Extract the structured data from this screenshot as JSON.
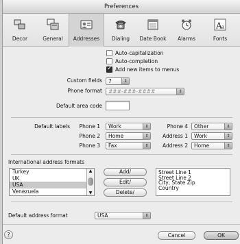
{
  "window": {
    "title": "Preferences"
  },
  "toolbar": {
    "items": [
      {
        "label": "Decor",
        "icon": "decor-icon"
      },
      {
        "label": "General",
        "icon": "general-icon"
      },
      {
        "label": "Addresses",
        "icon": "addresses-icon"
      },
      {
        "label": "Dialing",
        "icon": "telephone-icon"
      },
      {
        "label": "Date Book",
        "icon": "date-book-icon"
      },
      {
        "label": "Alarms",
        "icon": "alarm-clock-icon"
      },
      {
        "label": "Fonts",
        "icon": "fonts-icon"
      }
    ],
    "selected": "Addresses"
  },
  "options": {
    "auto_capitalization": {
      "label": "Auto-capitalization",
      "checked": false
    },
    "auto_completion": {
      "label": "Auto-completion",
      "checked": false
    },
    "add_new_items": {
      "label": "Add new items to menus",
      "checked": true
    }
  },
  "custom_fields": {
    "label": "Custom fields",
    "value": "7"
  },
  "phone_format": {
    "label": "Phone format",
    "value": "###-###-####"
  },
  "default_area_code": {
    "label": "Default area code",
    "value": ""
  },
  "default_labels": {
    "label": "Default labels",
    "rows": [
      {
        "left_label": "Phone 1",
        "left_value": "Work",
        "right_label": "Phone 4",
        "right_value": "Other"
      },
      {
        "left_label": "Phone 2",
        "left_value": "Home",
        "right_label": "Address 1",
        "right_value": "Work"
      },
      {
        "left_label": "Phone 3",
        "left_value": "Fax",
        "right_label": "Address 2",
        "right_value": "Home"
      }
    ]
  },
  "international": {
    "label": "International address formats",
    "countries": [
      "Turkey",
      "UK",
      "USA",
      "Venezuela"
    ],
    "selected": "USA",
    "buttons": {
      "add": "Add/",
      "edit": "Edit/",
      "delete": "Delete/"
    },
    "preview": [
      "Street Line 1",
      "Street Line 2",
      "City, State Zip",
      "Country"
    ]
  },
  "default_address_format": {
    "label": "Default address format",
    "value": "USA"
  },
  "footer": {
    "help": "?",
    "cancel": "Cancel",
    "ok": "OK"
  },
  "colors": {
    "window_bg": "#ececec",
    "selected_tab": "#d4d4d4",
    "list_selection": "#c8c8c8"
  }
}
